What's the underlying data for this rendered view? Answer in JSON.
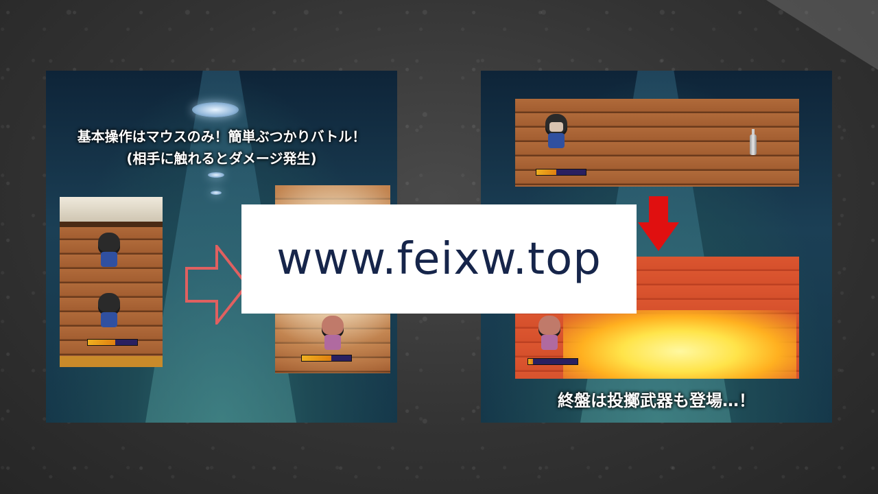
{
  "left_panel": {
    "caption_line1": "基本操作はマウスのみ！簡単ぶつかりバトル！",
    "caption_line2": "(相手に触れるとダメージ発生)"
  },
  "right_panel": {
    "caption": "終盤は投擲武器も登場…！"
  },
  "watermark": {
    "text": "www.feixw.top"
  },
  "colors": {
    "background": "#333333",
    "hp_fill": "#f0b020",
    "arrow_outline": "#e06060",
    "arrow_red": "#e01010",
    "watermark_text": "#16254a"
  },
  "hp_levels": {
    "scene1_player": 0.55,
    "scene2_player": 0.6,
    "scene3_player": 0.4,
    "scene4_player": 0.1
  }
}
